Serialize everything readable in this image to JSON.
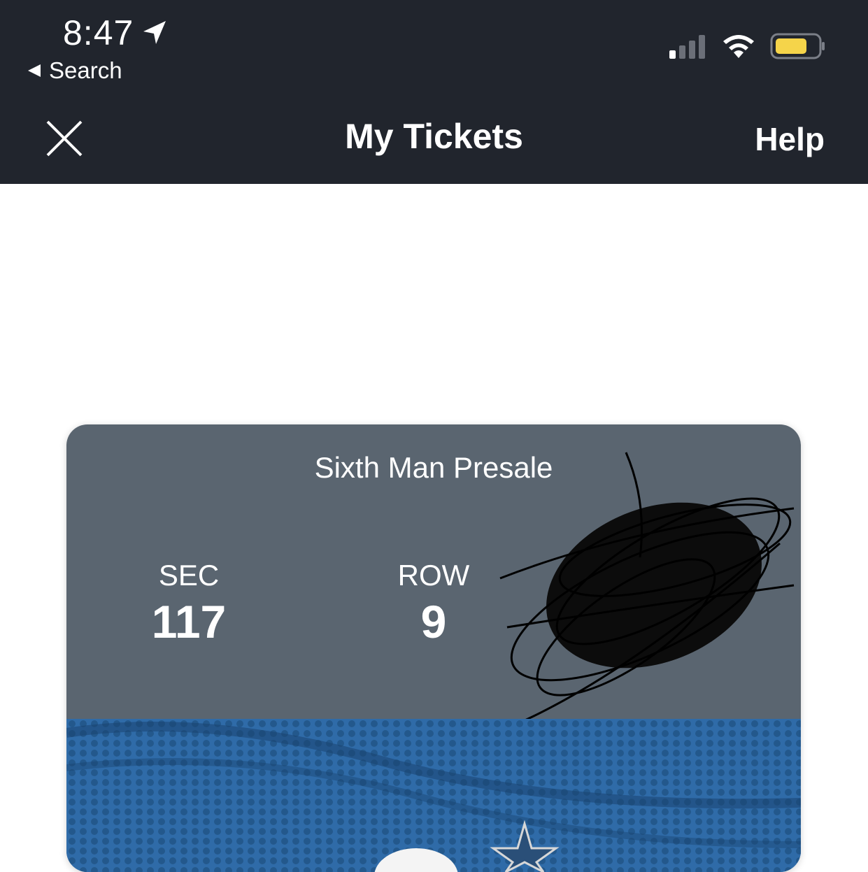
{
  "status_bar": {
    "time": "8:47",
    "back_label": "Search"
  },
  "nav": {
    "title": "My Tickets",
    "help_label": "Help"
  },
  "ticket": {
    "type": "Sixth Man Presale",
    "section_label": "SEC",
    "section_value": "117",
    "row_label": "ROW",
    "row_value": "9"
  },
  "colors": {
    "header_bg": "#21252d",
    "ticket_top_bg": "#5a6570",
    "ticket_bottom_bg": "#2e6aa6",
    "battery": "#f5d44a"
  },
  "icons": {
    "status": [
      "location-arrow-icon",
      "signal-icon",
      "wifi-icon",
      "battery-icon"
    ],
    "nav": [
      "close-icon"
    ]
  }
}
